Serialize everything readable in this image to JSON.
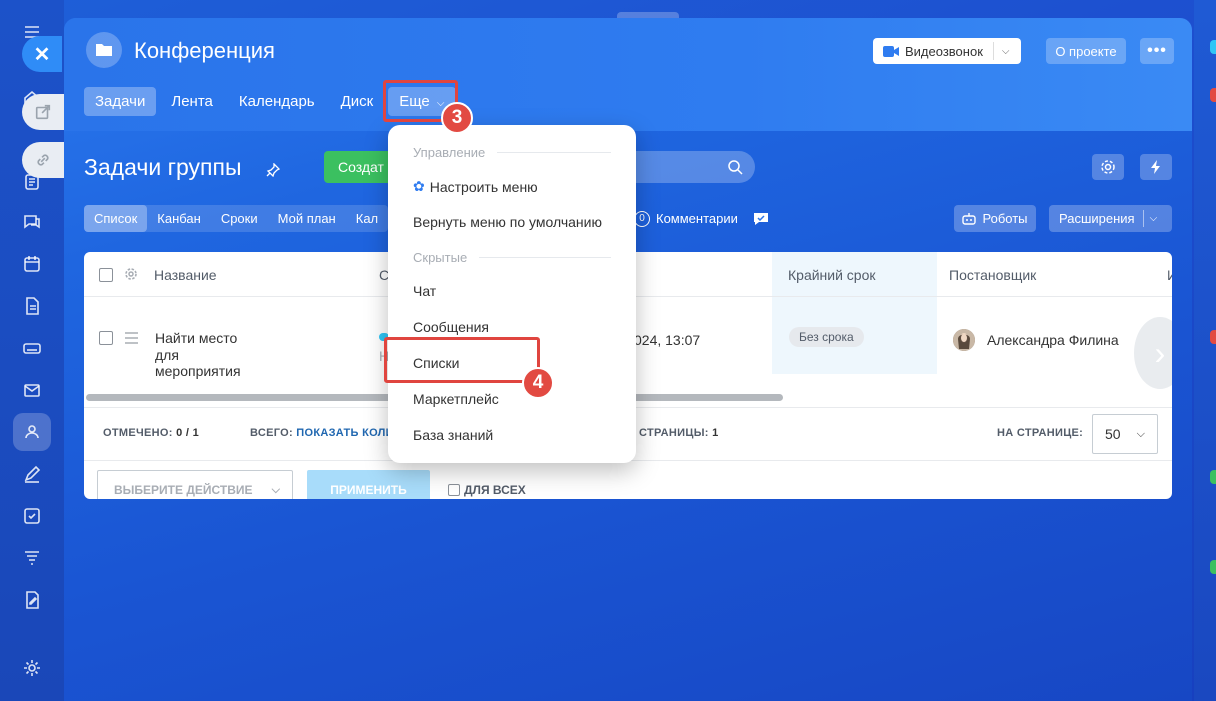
{
  "window": {
    "title": "Конференция",
    "video_call_label": "Видеозвонок",
    "about_label": "О проекте",
    "more_label": "•••"
  },
  "tabs": [
    {
      "label": "Задачи",
      "active": true
    },
    {
      "label": "Лента"
    },
    {
      "label": "Календарь"
    },
    {
      "label": "Диск"
    },
    {
      "label": "Еще"
    }
  ],
  "steps": {
    "step3": "3",
    "step4": "4"
  },
  "tasks": {
    "title": "Задачи группы",
    "create_label": "Создат"
  },
  "subtabs": [
    {
      "label": "Список",
      "active": true
    },
    {
      "label": "Канбан"
    },
    {
      "label": "Сроки"
    },
    {
      "label": "Мой план"
    },
    {
      "label": "Кал"
    }
  ],
  "comments": {
    "count": "0",
    "label": "Комментарии"
  },
  "toolbar": {
    "robots_label": "Роботы",
    "extensions_label": "Расширения"
  },
  "grid": {
    "headers": {
      "name": "Название",
      "status_partial": "С",
      "deadline": "Крайний срок",
      "creator": "Постановщик",
      "extra_partial": "И"
    },
    "row": {
      "name_line1": "Найти место",
      "name_line2": "для",
      "name_line3": "мероприятия",
      "status_partial": "Н",
      "date_partial": "024, 13:07",
      "deadline": "Без срока",
      "creator": "Александра Филина"
    },
    "footer": {
      "checked_label": "ОТМЕЧЕНО:",
      "checked_value": "0 / 1",
      "total_label": "ВСЕГО:",
      "total_link": "ПОКАЗАТЬ КОЛИ",
      "pages_label": "СТРАНИЦЫ:",
      "pages_value": "1",
      "per_page_label": "НА СТРАНИЦЕ:",
      "per_page_value": "50",
      "action_placeholder": "ВЫБЕРИТЕ ДЕЙСТВИЕ",
      "apply_label": "ПРИМЕНИТЬ",
      "for_all_label": "ДЛЯ ВСЕХ"
    }
  },
  "menu": {
    "section_manage": "Управление",
    "configure": "Настроить меню",
    "reset": "Вернуть меню по умолчанию",
    "section_hidden": "Скрытые",
    "items": [
      "Чат",
      "Сообщения",
      "Списки",
      "Маркетплейс",
      "База знаний"
    ]
  },
  "colors": {
    "accent": "#2f7cf0",
    "create": "#3bc060",
    "highlight": "#e0453f"
  }
}
